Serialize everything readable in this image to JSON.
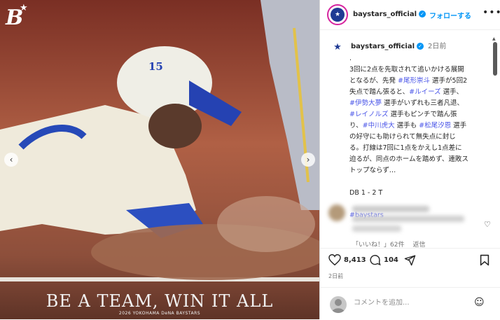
{
  "media": {
    "logo_text": "B",
    "slogan": "BE A TEAM, WIN IT ALL",
    "slogan_sub": "2026 YOKOHAMA DeNA BAYSTARS",
    "helmet_number": "15",
    "prev_arrow": "‹",
    "next_arrow": "›"
  },
  "header": {
    "username": "baystars_official",
    "follow_label": "フォローする",
    "more_icon": "•••"
  },
  "post": {
    "username": "baystars_official",
    "time": "2日前",
    "caption_parts": [
      {
        "t": ".",
        "tag": false
      },
      {
        "t": "\n3回に2点を先取されて追いかける展開となるが、先発 ",
        "tag": false
      },
      {
        "t": "#尾形崇斗",
        "tag": true
      },
      {
        "t": " 選手が5回2失点で踏ん張ると、",
        "tag": false
      },
      {
        "t": "#ルイーズ",
        "tag": true
      },
      {
        "t": " 選手、",
        "tag": false
      },
      {
        "t": "#伊勢大夢",
        "tag": true
      },
      {
        "t": " 選手がいずれも三者凡退、",
        "tag": false
      },
      {
        "t": "#レイノルズ",
        "tag": true
      },
      {
        "t": " 選手もピンチで踏ん張り、",
        "tag": false
      },
      {
        "t": "#中川虎大",
        "tag": true
      },
      {
        "t": " 選手も ",
        "tag": false
      },
      {
        "t": "#松尾汐恩",
        "tag": true
      },
      {
        "t": " 選手の好守にも助けられて無失点に封じる。打線は7回に1点をかえし1点差に迫るが、同点のホームを踏めず、連敗ストップならず…",
        "tag": false
      },
      {
        "t": "\n\nDB 1 - 2 T\n\n",
        "tag": false
      },
      {
        "t": "#baystars",
        "tag": true
      }
    ]
  },
  "comment": {
    "meta_likes": "「いいね！」62件",
    "meta_reply": "返信"
  },
  "actions": {
    "likes": "8,413",
    "comments": "104",
    "post_time": "2日前"
  },
  "add_comment": {
    "placeholder": "コメントを追加..."
  },
  "colors": {
    "accent": "#0095f6",
    "hashtag": "#4a55e8",
    "brand_blue": "#1f3a93"
  }
}
